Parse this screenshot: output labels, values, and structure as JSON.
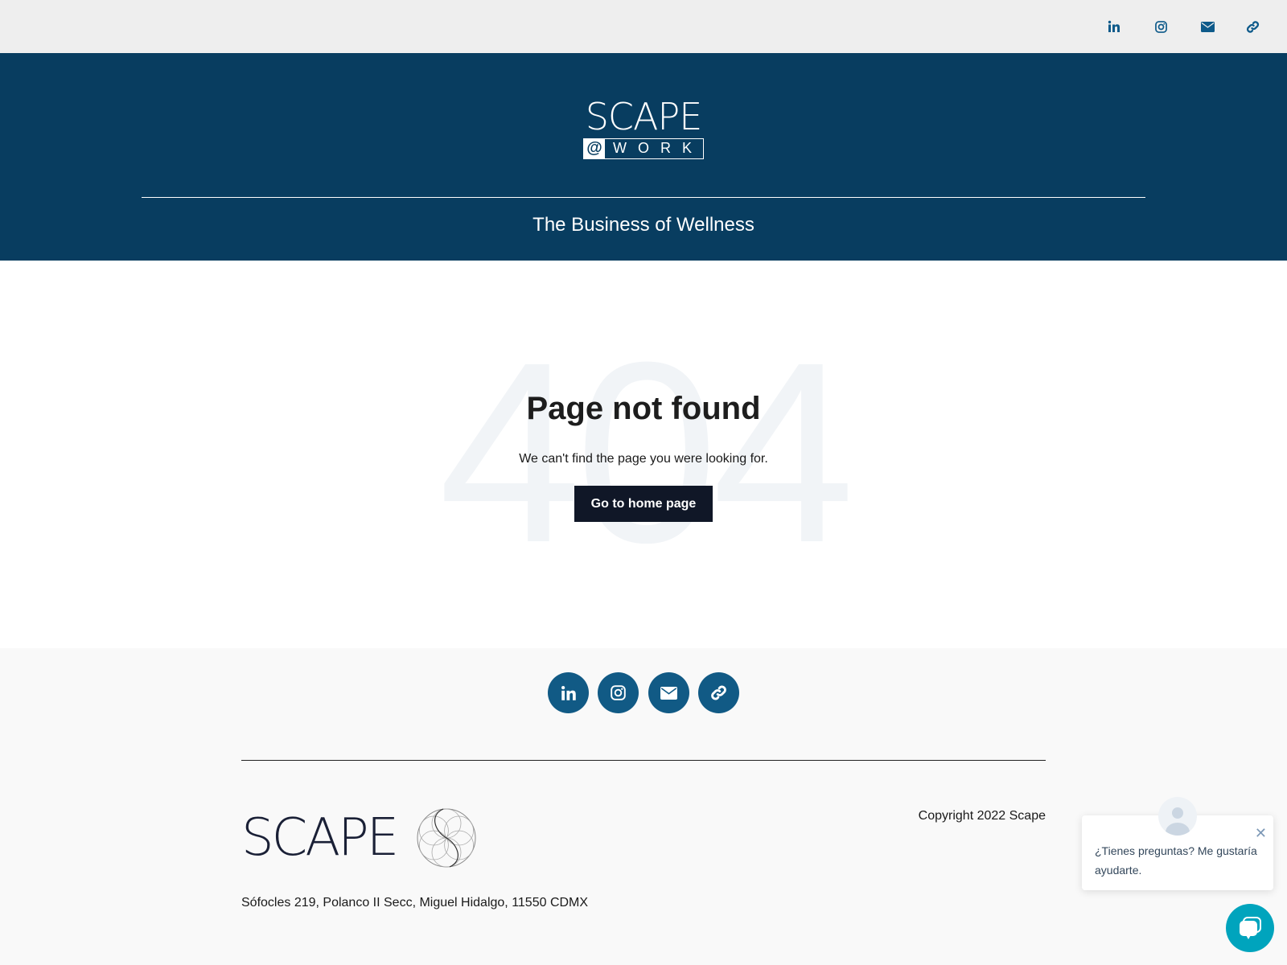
{
  "topbar": {
    "icons": [
      "linkedin-icon",
      "instagram-icon",
      "email-icon",
      "link-icon"
    ]
  },
  "header": {
    "logo_main": "SCAPE",
    "logo_at": "@",
    "logo_sub": "WORK",
    "tagline": "The Business of Wellness"
  },
  "main": {
    "bg_text": "404",
    "title": "Page not found",
    "subtitle": "We can't find the page you were looking for.",
    "button": "Go to home page"
  },
  "footer": {
    "icons": [
      "linkedin-icon",
      "instagram-icon",
      "email-icon",
      "link-icon"
    ],
    "logo": "SCAPE",
    "copyright": "Copyright 2022 Scape",
    "address": "Sófocles 219, Polanco II Secc, Miguel Hidalgo, 11550 CDMX"
  },
  "chat": {
    "message": "¿Tienes preguntas? Me gustaría ayudarte.",
    "close": "✕"
  },
  "colors": {
    "header": "#083d60",
    "icon": "#115a85",
    "button": "#101727",
    "chat": "#00a4bd"
  }
}
